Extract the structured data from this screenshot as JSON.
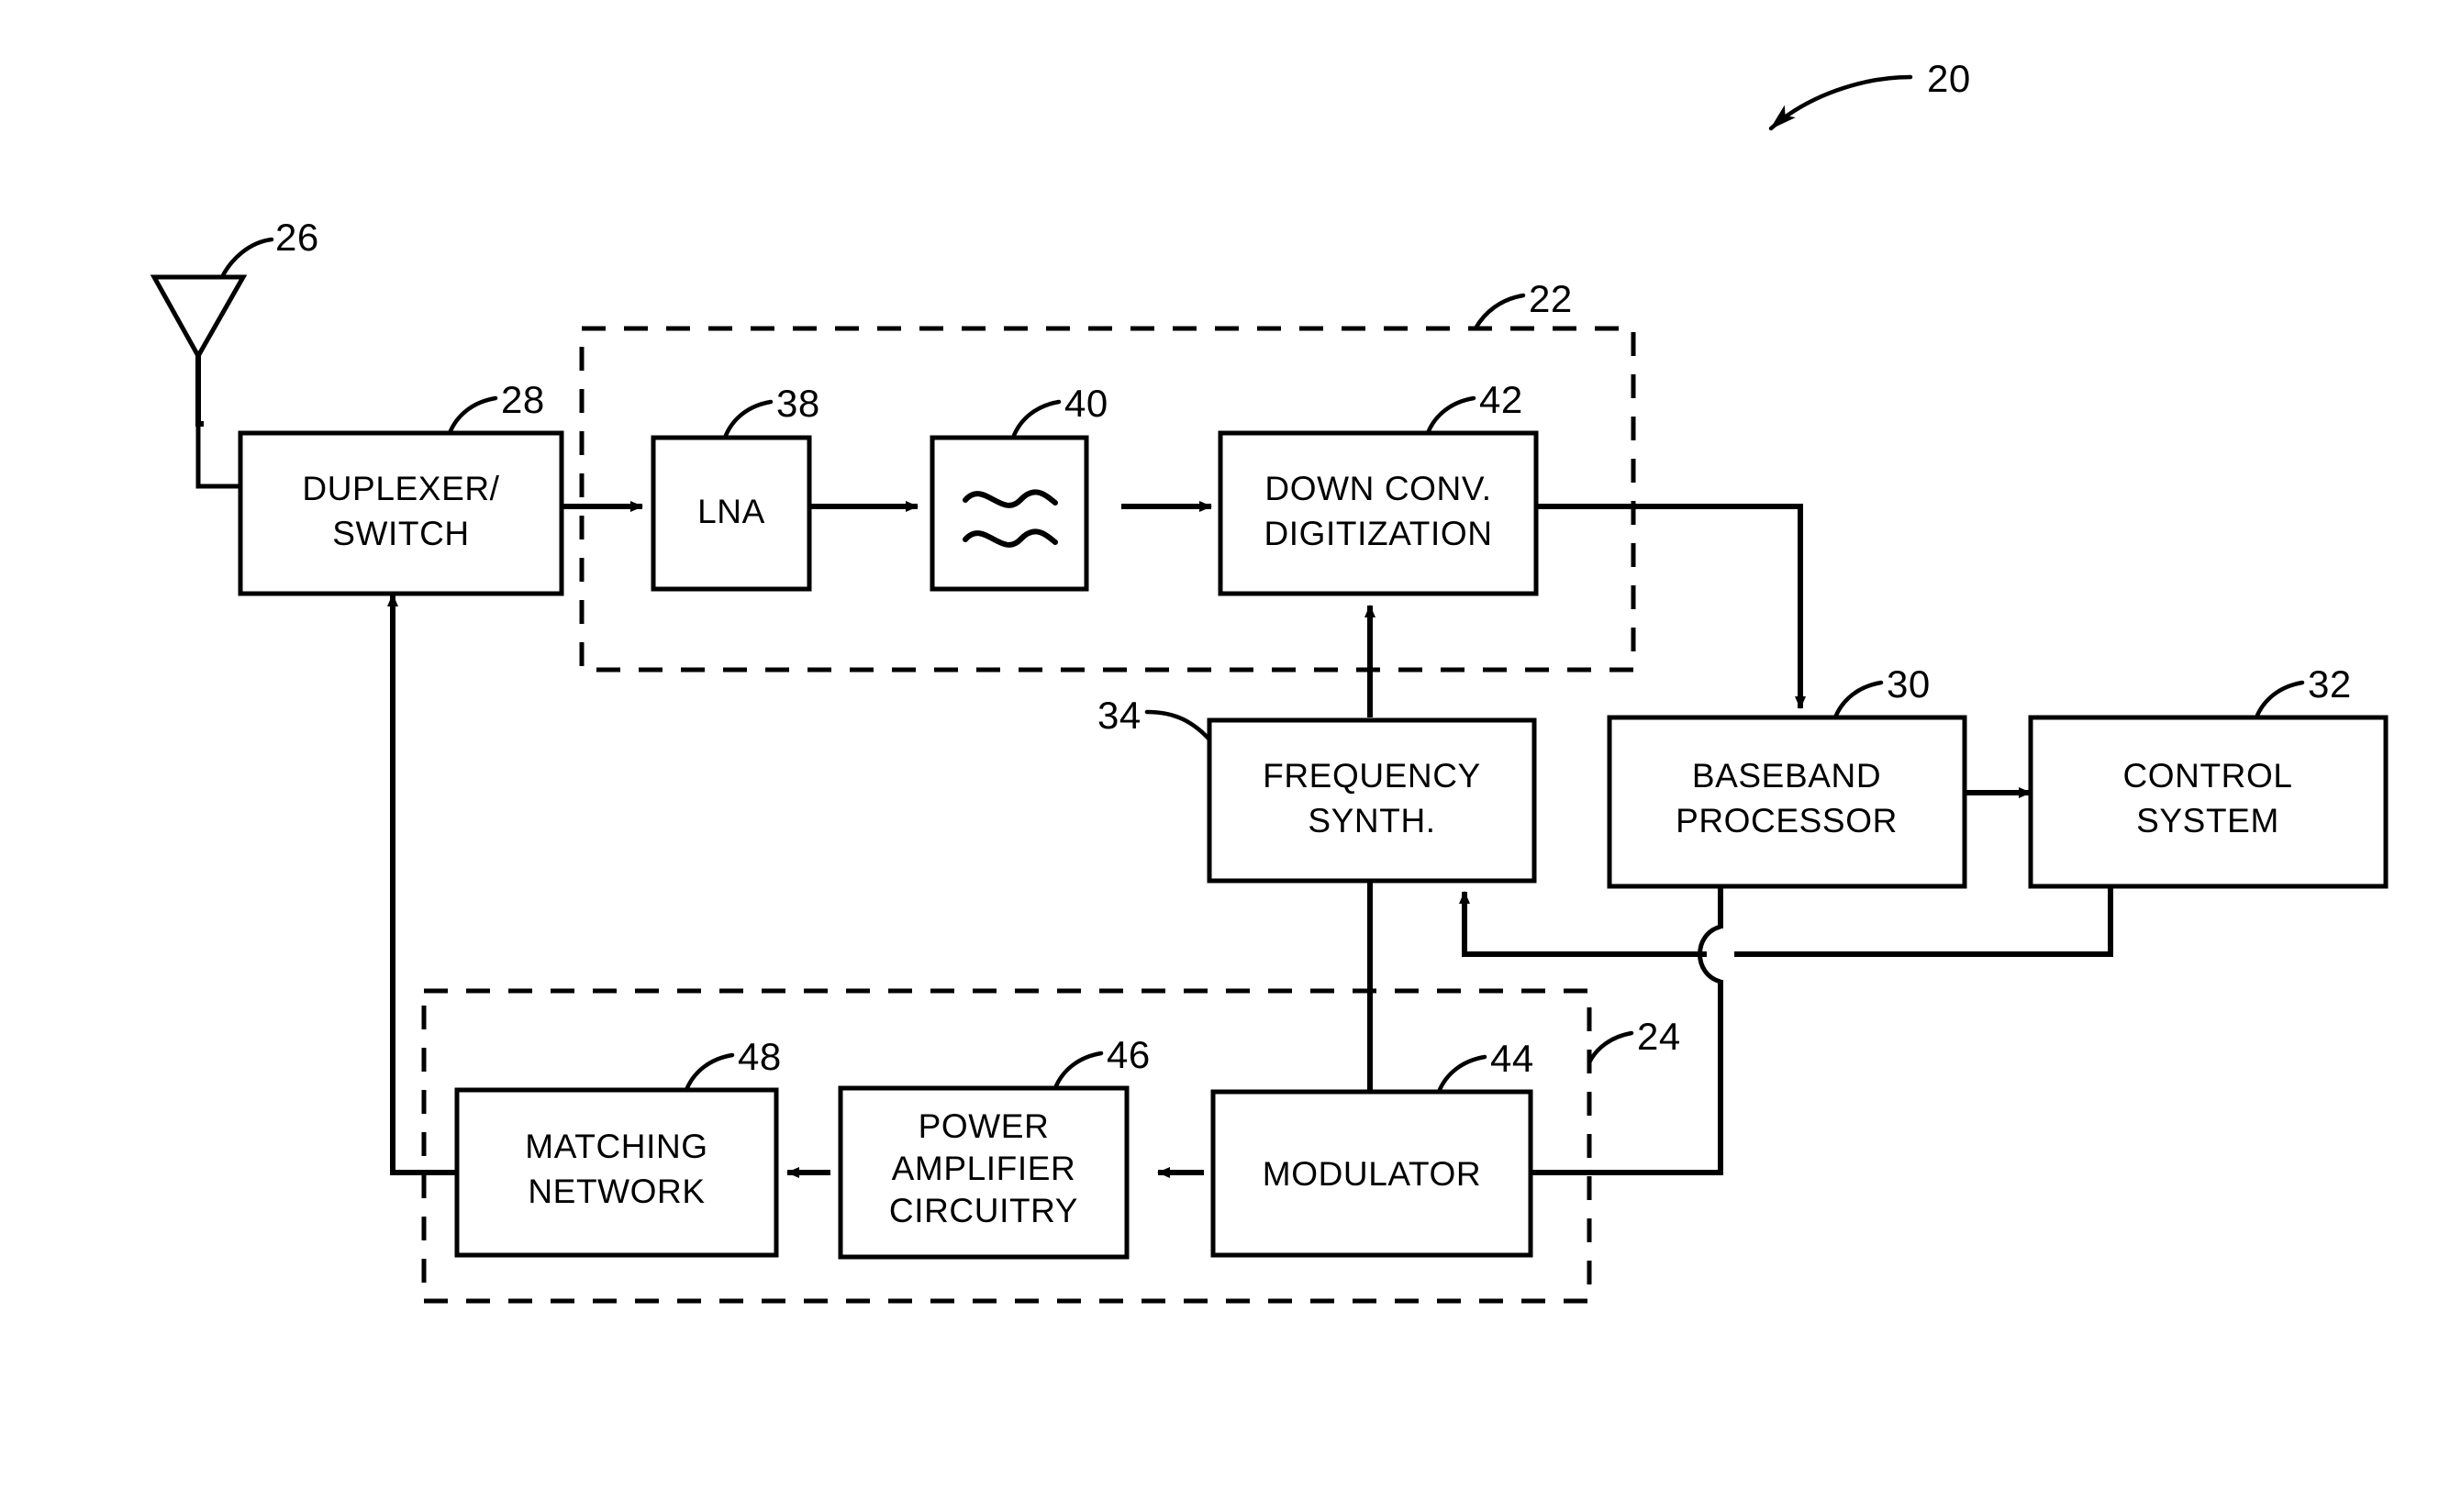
{
  "figure": {
    "title": "RF transceiver block diagram",
    "system_reference": "20",
    "line_color": "#000000",
    "background_color": "#ffffff"
  },
  "antenna": {
    "name": "antenna",
    "reference": "26"
  },
  "blocks": [
    {
      "id": "duplexer",
      "label_lines": [
        "DUPLEXER/",
        "SWITCH"
      ],
      "reference": "28"
    },
    {
      "id": "lna",
      "label_lines": [
        "LNA"
      ],
      "reference": "38"
    },
    {
      "id": "filter",
      "label_lines": [
        "≈"
      ],
      "reference": "40"
    },
    {
      "id": "downconv",
      "label_lines": [
        "DOWN CONV.",
        "DIGITIZATION"
      ],
      "reference": "42"
    },
    {
      "id": "freqsynth",
      "label_lines": [
        "FREQUENCY",
        "SYNTH."
      ],
      "reference": "34"
    },
    {
      "id": "baseband",
      "label_lines": [
        "BASEBAND",
        "PROCESSOR"
      ],
      "reference": "30"
    },
    {
      "id": "control",
      "label_lines": [
        "CONTROL",
        "SYSTEM"
      ],
      "reference": "32"
    },
    {
      "id": "matching",
      "label_lines": [
        "MATCHING",
        "NETWORK"
      ],
      "reference": "48"
    },
    {
      "id": "pa",
      "label_lines": [
        "POWER",
        "AMPLIFIER",
        "CIRCUITRY"
      ],
      "reference": "46"
    },
    {
      "id": "modulator",
      "label_lines": [
        "MODULATOR"
      ],
      "reference": "44"
    }
  ],
  "dashed_groups": [
    {
      "id": "receiver-group",
      "reference": "22"
    },
    {
      "id": "transmitter-group",
      "reference": "24"
    }
  ],
  "labels": {
    "ref_20": "20",
    "ref_22": "22",
    "ref_24": "24",
    "ref_26": "26",
    "ref_28": "28",
    "ref_30": "30",
    "ref_32": "32",
    "ref_34": "34",
    "ref_38": "38",
    "ref_40": "40",
    "ref_42": "42",
    "ref_44": "44",
    "ref_46": "46",
    "ref_48": "48",
    "duplexer_l1": "DUPLEXER/",
    "duplexer_l2": "SWITCH",
    "lna_l1": "LNA",
    "filter_l1": "≈",
    "downconv_l1": "DOWN CONV.",
    "downconv_l2": "DIGITIZATION",
    "freqsynth_l1": "FREQUENCY",
    "freqsynth_l2": "SYNTH.",
    "baseband_l1": "BASEBAND",
    "baseband_l2": "PROCESSOR",
    "control_l1": "CONTROL",
    "control_l2": "SYSTEM",
    "matching_l1": "MATCHING",
    "matching_l2": "NETWORK",
    "pa_l1": "POWER",
    "pa_l2": "AMPLIFIER",
    "pa_l3": "CIRCUITRY",
    "modulator_l1": "MODULATOR"
  }
}
